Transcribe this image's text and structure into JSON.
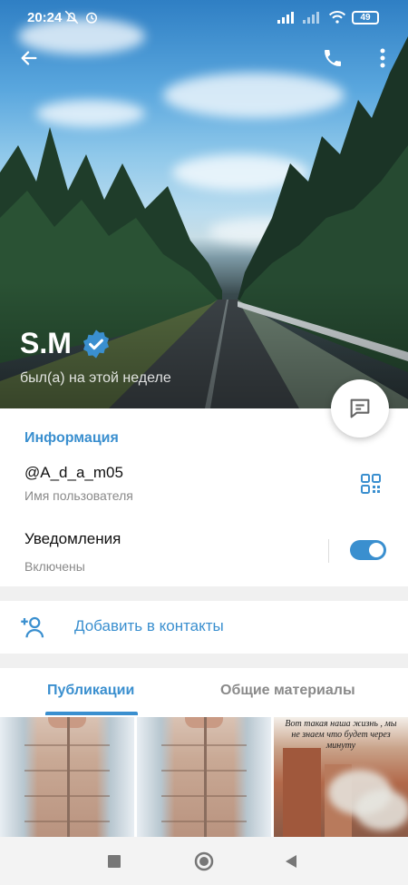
{
  "status_bar": {
    "time": "20:24",
    "battery": "49"
  },
  "profile": {
    "name": "S.M",
    "last_seen": "был(а) на этой неделе",
    "verified": true
  },
  "info": {
    "section_title": "Информация",
    "username_value": "@A_d_a_m05",
    "username_label": "Имя пользователя",
    "notifications_title": "Уведомления",
    "notifications_value": "Включены",
    "notifications_enabled": true
  },
  "actions": {
    "add_contact_label": "Добавить в контакты"
  },
  "tabs": [
    {
      "label": "Публикации",
      "active": true
    },
    {
      "label": "Общие материалы",
      "active": false
    }
  ],
  "media": [
    {
      "kind": "photo-jacket"
    },
    {
      "kind": "photo-jacket"
    },
    {
      "kind": "photo-city",
      "caption": "Вот такая наша жизнь , мы не знаем что будет через минуту"
    }
  ],
  "colors": {
    "accent": "#3a8fcf",
    "secondary_text": "#8a8a8a",
    "divider": "#f0f0f0"
  },
  "icons": {
    "back": "arrow-left-icon",
    "call": "phone-icon",
    "more": "more-vertical-icon",
    "verified": "verified-badge-icon",
    "message": "message-icon",
    "qr": "qr-code-icon",
    "add_contact": "add-user-icon"
  }
}
